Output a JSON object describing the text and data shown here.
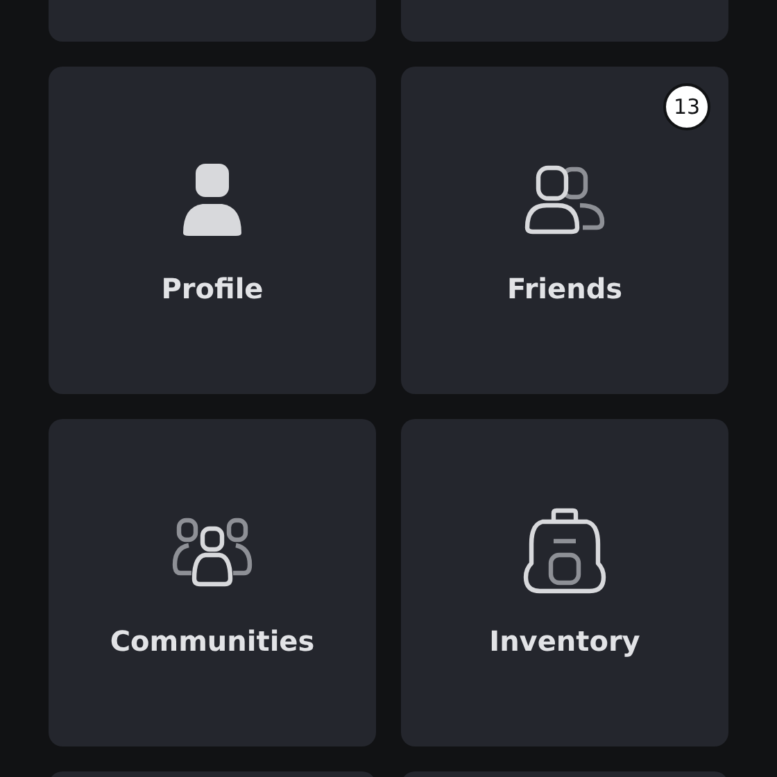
{
  "tiles": [
    {
      "label": "Profile",
      "kind": "profile"
    },
    {
      "label": "Friends",
      "kind": "friends",
      "badge": "13"
    },
    {
      "label": "Communities",
      "kind": "communities"
    },
    {
      "label": "Inventory",
      "kind": "inventory"
    }
  ]
}
